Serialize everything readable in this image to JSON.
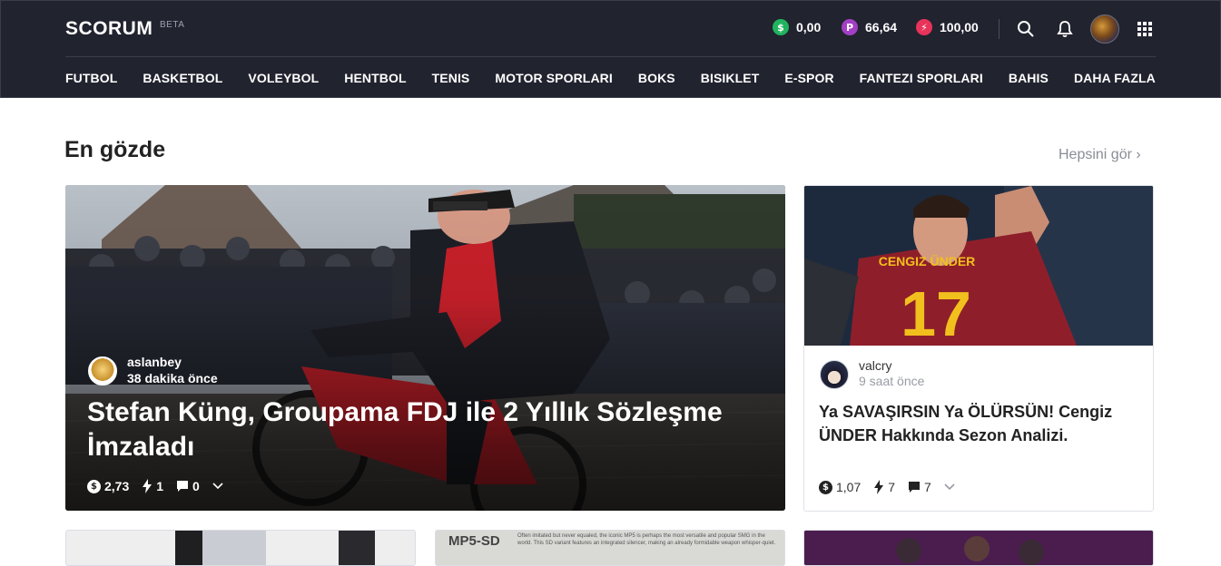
{
  "header": {
    "logo": "SCORUM",
    "beta": "BETA",
    "wallet": [
      {
        "icon": "dollar-coin-icon",
        "symbol": "$",
        "color": "#21b35f",
        "value": "0,00"
      },
      {
        "icon": "power-coin-icon",
        "symbol": "P",
        "color": "#a23fc4",
        "value": "66,64"
      },
      {
        "icon": "energy-coin-icon",
        "symbol": "⚡",
        "color": "#e8335a",
        "value": "100,00"
      }
    ]
  },
  "nav": [
    "FUTBOL",
    "BASKETBOL",
    "VOLEYBOL",
    "HENTBOL",
    "TENIS",
    "MOTOR SPORLARI",
    "BOKS",
    "BISIKLET",
    "E-SPOR",
    "FANTEZI SPORLARI",
    "BAHIS",
    "DAHA FAZLA"
  ],
  "section": {
    "title": "En gözde",
    "see_all": "Hepsini gör ›"
  },
  "hero": {
    "author": "aslanbey",
    "time": "38 dakika önce",
    "title": "Stefan Küng, Groupama FDJ ile 2 Yıllık Sözleşme İmzaladı",
    "payout": "2,73",
    "votes": "1",
    "comments": "0"
  },
  "card": {
    "author": "valcry",
    "time": "9 saat önce",
    "title": "Ya SAVAŞIRSIN Ya ÖLÜRSÜN! Cengiz ÜNDER Hakkında Sezon Analizi.",
    "payout": "1,07",
    "votes": "7",
    "comments": "7"
  },
  "bottom": {
    "mp5_label": "MP5-SD",
    "mp5_text": "Often imitated but never equaled, the iconic MP5 is perhaps the most versatile and popular SMG in the world. This SD variant features an integrated silencer, making an already formidable weapon whisper-quiet."
  }
}
